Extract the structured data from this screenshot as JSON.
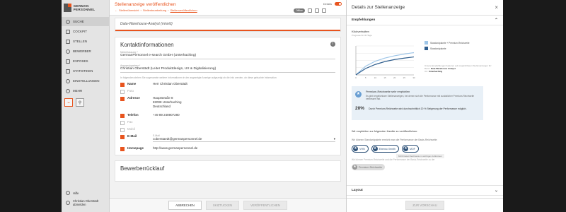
{
  "logo": {
    "text": "GERMAN PERSONNEL"
  },
  "sidebar": {
    "items": [
      {
        "label": "SUCHE",
        "icon": "search-icon"
      },
      {
        "label": "COCKPIT",
        "icon": "dashboard-icon"
      },
      {
        "label": "STELLEN",
        "icon": "briefcase-icon"
      },
      {
        "label": "BEWERBER",
        "icon": "users-icon"
      },
      {
        "label": "EXPOSES",
        "icon": "document-icon"
      },
      {
        "label": "STATISTIKEN",
        "icon": "chart-icon"
      },
      {
        "label": "EINSTELLUNGEN",
        "icon": "gear-icon"
      },
      {
        "label": "MEHR",
        "icon": "more-icon"
      }
    ],
    "help": "Hilfe",
    "user": "Christian Oberstädt abmelden"
  },
  "header": {
    "title": "Stellenanzeige veröffentlichen",
    "breadcrumb": [
      "Stellenübersicht",
      "Stellenbearbeitung",
      "Stellenveröffentlichen"
    ],
    "details_label": "Details",
    "status_pill": "Offline"
  },
  "job": {
    "title": "Data-Warehouse-Analyst (m/w/d)"
  },
  "contact": {
    "section_title": "Kontaktinformationen",
    "company_label": "Niederlassung *",
    "company": "GermanPersonnel e-search GmbH (Unterhaching)",
    "person_label": "Ansprechpartner *",
    "person": "Christian Oberstädt (Leiter Produktdesign, UX & Digitalisierung)",
    "note": "In folgenden stehen Sie sogenannte weitere Informationen in der angezeigte Anzeige aufgezeigt ob die Info werden, ob diese gebuchte Information",
    "rows": [
      {
        "label": "Name",
        "value": "Herr Christian Oberstädt",
        "checked": true
      },
      {
        "label": "Foto",
        "value": "",
        "checked": false
      },
      {
        "label": "Adresse",
        "value": "Hauptstraße 8\n82008 Unterhaching\nDeutschland",
        "checked": true
      },
      {
        "label": "Telefon",
        "value": "+49 89 248907280",
        "checked": true
      },
      {
        "label": "Fax",
        "value": "",
        "checked": false
      },
      {
        "label": "Mobil",
        "value": "",
        "checked": false
      },
      {
        "label": "E-Mail",
        "value": "coberstaedt@germanpersonnel.de",
        "checked": true
      },
      {
        "label": "Homepage",
        "value": "http://www.germanpersonnel.de",
        "checked": true
      }
    ],
    "email_field_label": "E-Mail"
  },
  "feedback": {
    "section_title": "Bewerberrücklauf"
  },
  "footer": {
    "cancel": "ABBRECHEN",
    "save": "SKIZTUCKEN",
    "publish": "VERÖFFENTLICHEN"
  },
  "panel": {
    "title": "Details zur Stellenanzeige",
    "accordion_recommendations": "Empfehlungen",
    "klicks_label": "Klickverhalten",
    "prognose": "Prognose für 30 Tage",
    "legend": [
      {
        "name": "Standardpakete + Premium-Reichweite",
        "color": "#9fc6e8"
      },
      {
        "name": "Standardpakete",
        "color": "#2f5e8e"
      }
    ],
    "chart_note": "Unsere Empfehlungen basieren auf vergleichbaren Stellenanzeigen für:",
    "chart_note_beruf_k": "Beruf:",
    "chart_note_beruf": "Data Warehouse Analyst",
    "chart_note_ort_k": "Ort:",
    "chart_note_ort": "Unterhaching",
    "promo_title": "Premium-Reichweite sehr empfohlen",
    "promo_text": "Es gibt vergleichbare Stellenanzeigen, bei denen sich die Performance mit zusätzlicher Premium-Reichweite verbessert hat.",
    "promo_pct": "20%",
    "promo_pct_text": "Durch Premium-Reichweite wird durchschnittlich 20 % Steigerung der Performance möglich.",
    "recommend_text": "Wir empfehlen zur folgenden Kanäle zu veröffentlichen:",
    "recommend_sub": "Wir können Standardpakete erreicht man die Performance der Basis-Reichweite:",
    "channels": [
      "VHN",
      "Ebenso Xenith",
      "MOF"
    ],
    "tooltip": "MOF bietet Reichweite in wichtigen Jobbörsen",
    "recommend_sub2": "Wir können Premium-Reichweite und die Performance der Basis-Reichweite zu der",
    "premium_chip": "Premium-Reichweite",
    "accordion_layout": "Layout",
    "preview_button": "ZUR VORSCHAU"
  },
  "chart_data": {
    "type": "line",
    "title": "Prognose für 30 Tage",
    "x": [
      0,
      5,
      10,
      15,
      20,
      25,
      30
    ],
    "xlim": [
      0,
      30
    ],
    "series": [
      {
        "name": "Standardpakete + Premium-Reichweite",
        "values": [
          0,
          30,
          47,
          58,
          66,
          72,
          77
        ]
      },
      {
        "name": "Standardpakete",
        "values": [
          0,
          22,
          36,
          46,
          53,
          58,
          62
        ]
      }
    ],
    "grid": true
  }
}
